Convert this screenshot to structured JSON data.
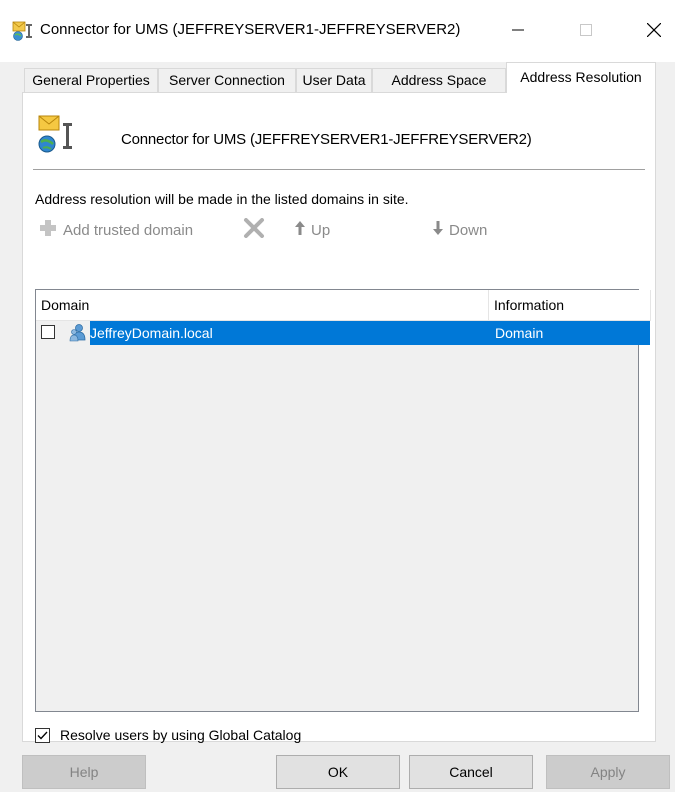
{
  "window": {
    "title": "Connector for UMS (JEFFREYSERVER1-JEFFREYSERVER2)",
    "icon": "connector-icon",
    "controls": {
      "minimize": "minimize-icon",
      "maximize": "maximize-icon",
      "close": "close-icon"
    }
  },
  "tabs": [
    {
      "label": "General Properties",
      "active": false
    },
    {
      "label": "Server Connection",
      "active": false
    },
    {
      "label": "User Data",
      "active": false
    },
    {
      "label": "Address Space",
      "active": false
    },
    {
      "label": "Address Resolution",
      "active": true
    }
  ],
  "page": {
    "connector_name": "Connector for UMS (JEFFREYSERVER1-JEFFREYSERVER2)",
    "description": "Address resolution will be made in the listed domains in site.",
    "toolbar": {
      "add_label": "Add trusted domain",
      "up_label": "Up",
      "down_label": "Down",
      "enabled": false
    },
    "list": {
      "columns": [
        "Domain",
        "Information"
      ],
      "rows": [
        {
          "checked": false,
          "selected": true,
          "domain": "JeffreyDomain.local",
          "information": "Domain",
          "icon": "domain-icon"
        }
      ]
    },
    "global_catalog": {
      "label": "Resolve users by using Global Catalog",
      "checked": true
    }
  },
  "buttons": {
    "help": "Help",
    "ok": "OK",
    "cancel": "Cancel",
    "apply": "Apply"
  },
  "colors": {
    "selection": "#0078d7",
    "dialog_bg": "#f0f0f0",
    "disabled_text": "#8a8a8a"
  }
}
